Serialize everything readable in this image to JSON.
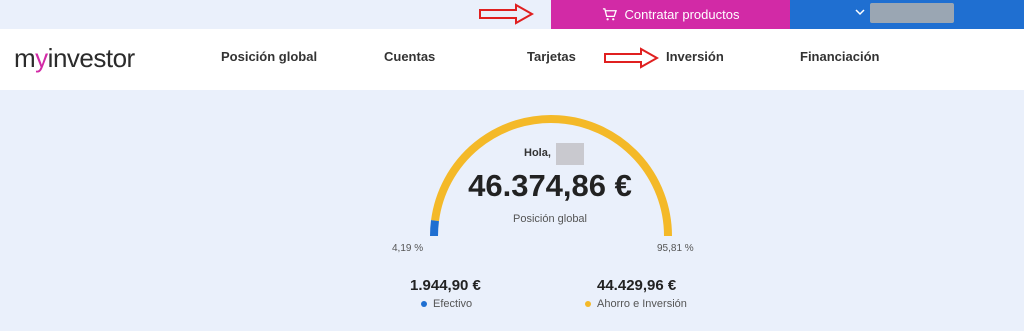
{
  "topbar": {
    "contratar_label": "Contratar productos"
  },
  "nav": {
    "logo": {
      "prefix": "m",
      "highlight": "y",
      "suffix": "investor"
    },
    "items": [
      "Posición global",
      "Cuentas",
      "Tarjetas",
      "Inversión",
      "Financiación"
    ]
  },
  "summary": {
    "greeting": "Hola,",
    "total": "46.374,86 €",
    "total_label": "Posición global",
    "efectivo_pct_label": "4,19 %",
    "ahorro_pct_label": "95,81 %",
    "efectivo_amount": "1.944,90 €",
    "efectivo_label": "Efectivo",
    "ahorro_amount": "44.429,96 €",
    "ahorro_label": "Ahorro e Inversión",
    "efectivo_fraction": 0.0419
  },
  "colors": {
    "accent_magenta": "#d22aa6",
    "accent_blue": "#1f6fd1",
    "gauge_yellow": "#f4b928",
    "gauge_blue": "#1f6fd1",
    "annotation_red": "#e02020"
  }
}
